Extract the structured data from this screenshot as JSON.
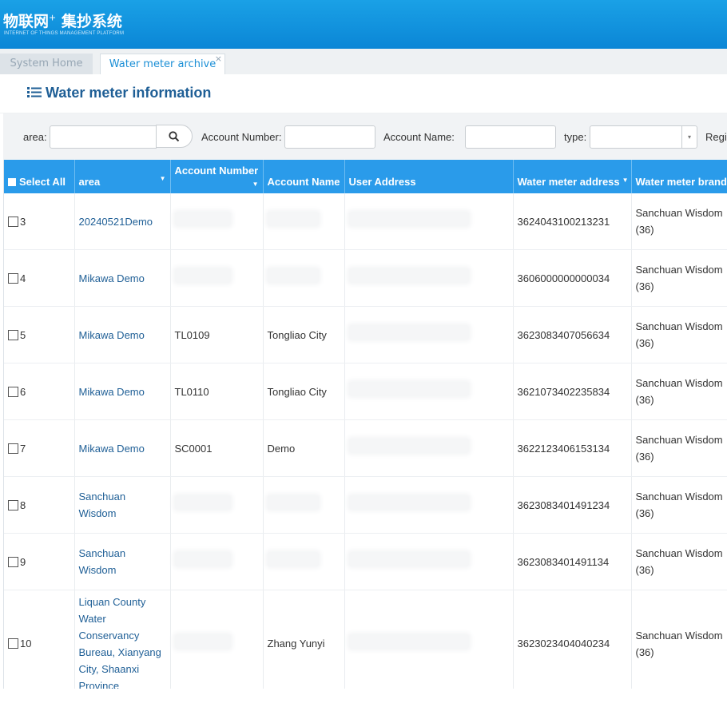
{
  "header": {
    "brand": "物联网",
    "brand_sup": "+",
    "product": "集抄系统",
    "subtitle": "INTERNET OF THINGS MANAGEMENT PLATFORM"
  },
  "tabs": [
    {
      "label": "System Home"
    },
    {
      "label": "Water meter archive",
      "close": "×"
    }
  ],
  "page": {
    "title": "Water meter information",
    "title_icon": "list-icon"
  },
  "filters": {
    "area_label": "area:",
    "account_number_label": "Account Number:",
    "account_name_label": "Account Name:",
    "type_label": "type:",
    "region_label": "Regi",
    "search_icon": "search-icon",
    "select_arrow": "▾"
  },
  "table": {
    "headers": {
      "select_all": "Select All",
      "area": "area",
      "account_number": "Account Number",
      "account_name": "Account Name",
      "user_address": "User Address",
      "water_meter_address": "Water meter address",
      "water_meter_brand": "Water meter brand"
    },
    "rows": [
      {
        "no": "3",
        "area": "20240521Demo",
        "account_number": "",
        "account_name": "",
        "address": "3624043100213231",
        "brand": "Sanchuan Wisdom (36)"
      },
      {
        "no": "4",
        "area": "Mikawa Demo",
        "account_number": "",
        "account_name": "",
        "address": "3606000000000034",
        "brand": "Sanchuan Wisdom (36)"
      },
      {
        "no": "5",
        "area": "Mikawa Demo",
        "account_number": "TL0109",
        "account_name": "Tongliao City",
        "address": "3623083407056634",
        "brand": "Sanchuan Wisdom (36)"
      },
      {
        "no": "6",
        "area": "Mikawa Demo",
        "account_number": "TL0110",
        "account_name": "Tongliao City",
        "address": "3621073402235834",
        "brand": "Sanchuan Wisdom (36)"
      },
      {
        "no": "7",
        "area": "Mikawa Demo",
        "account_number": "SC0001",
        "account_name": "Demo",
        "address": "3622123406153134",
        "brand": "Sanchuan Wisdom (36)"
      },
      {
        "no": "8",
        "area": "Sanchuan Wisdom",
        "account_number": "",
        "account_name": "",
        "address": "3623083401491234",
        "brand": "Sanchuan Wisdom (36)"
      },
      {
        "no": "9",
        "area": "Sanchuan Wisdom",
        "account_number": "",
        "account_name": "",
        "address": "3623083401491134",
        "brand": "Sanchuan Wisdom (36)"
      },
      {
        "no": "10",
        "area": "Liquan County Water Conservancy Bureau, Xianyang City, Shaanxi Province",
        "account_number": "",
        "account_name": "Zhang Yunyi",
        "address": "3623023404040234",
        "brand": "Sanchuan Wisdom (36)"
      }
    ]
  },
  "colors": {
    "header_blue": "#0b86d6",
    "table_header": "#2a9bea",
    "link": "#1f5f96",
    "tab_active": "#1b8fd6"
  }
}
